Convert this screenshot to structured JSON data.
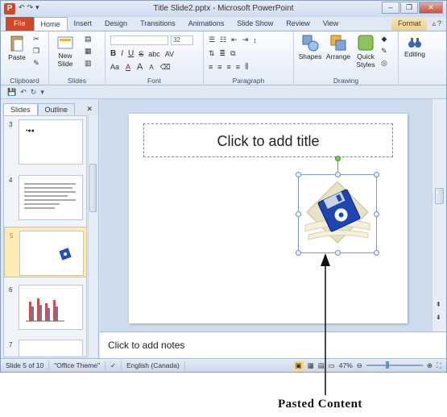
{
  "window": {
    "title": "Title Slide2.pptx - Microsoft PowerPoint",
    "app_icon_label": "P",
    "qat": [
      "↶",
      "↷",
      "▾"
    ],
    "controls": [
      "–",
      "❐",
      "✕"
    ]
  },
  "tabs": [
    {
      "label": "File"
    },
    {
      "label": "Home"
    },
    {
      "label": "Insert"
    },
    {
      "label": "Design"
    },
    {
      "label": "Transitions"
    },
    {
      "label": "Animations"
    },
    {
      "label": "Slide Show"
    },
    {
      "label": "Review"
    },
    {
      "label": "View"
    },
    {
      "label": "Format"
    }
  ],
  "ribbon": {
    "clipboard": {
      "label": "Clipboard",
      "paste": "Paste"
    },
    "slides": {
      "label": "Slides",
      "new_slide": "New Slide"
    },
    "font": {
      "label": "Font",
      "size": "32",
      "bold": "B",
      "italic": "I",
      "underline": "U",
      "strike": "S",
      "shadow": "abc",
      "spacing": "AV",
      "case": "Aa",
      "color": "A",
      "grow": "A",
      "shrink": "A"
    },
    "paragraph": {
      "label": "Paragraph"
    },
    "drawing": {
      "label": "Drawing",
      "shapes": "Shapes",
      "arrange": "Arrange",
      "quick_styles": "Quick Styles"
    },
    "editing": {
      "label": "Editing"
    }
  },
  "slides_pane": {
    "tabs": [
      "Slides",
      "Outline"
    ],
    "close": "✕",
    "thumbs": [
      {
        "num": "3",
        "selected": false
      },
      {
        "num": "4",
        "selected": false
      },
      {
        "num": "5",
        "selected": true
      },
      {
        "num": "6",
        "selected": false
      },
      {
        "num": "7",
        "selected": false
      }
    ]
  },
  "slide": {
    "title_placeholder": "Click to add title"
  },
  "notes": {
    "placeholder": "Click to add notes"
  },
  "status_bar": {
    "slide_info": "Slide 5 of 10",
    "theme": "\"Office Theme\"",
    "language": "English (Canada)",
    "zoom": "47%"
  },
  "annotation": {
    "label": "Pasted Content"
  },
  "colors": {
    "file_tab": "#d24726",
    "selected_thumb": "#fcebb3",
    "rotate_handle": "#6cd24a"
  }
}
